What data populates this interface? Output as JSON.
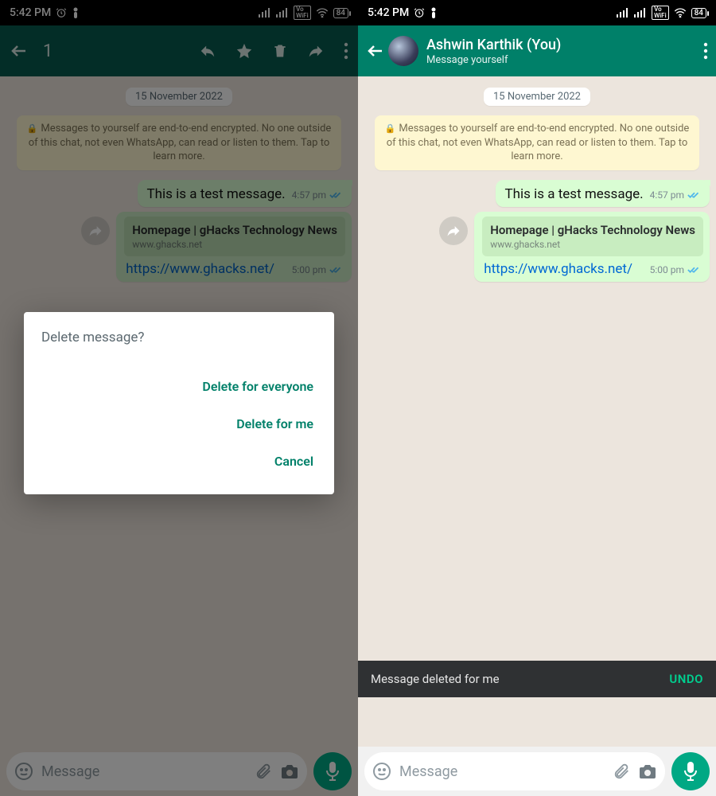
{
  "status": {
    "time": "5:42 PM",
    "battery": "84"
  },
  "left": {
    "selection_count": "1",
    "date_pill": "15 November 2022",
    "encryption_notice": "Messages to yourself are end-to-end encrypted. No one outside of this chat, not even WhatsApp, can read or listen to them. Tap to learn more.",
    "msg1": {
      "text": "This is a test message.",
      "time": "4:57 pm"
    },
    "msg2": {
      "preview_title": "Homepage | gHacks Technology News",
      "preview_domain": "www.ghacks.net",
      "link": "https://www.ghacks.net/",
      "time": "5:00 pm"
    },
    "dialog": {
      "title": "Delete message?",
      "btn_everyone": "Delete for everyone",
      "btn_me": "Delete for me",
      "btn_cancel": "Cancel"
    },
    "composer_placeholder": "Message"
  },
  "right": {
    "contact_name": "Ashwin Karthik (You)",
    "contact_sub": "Message yourself",
    "date_pill": "15 November 2022",
    "encryption_notice": "Messages to yourself are end-to-end encrypted. No one outside of this chat, not even WhatsApp, can read or listen to them. Tap to learn more.",
    "msg1": {
      "text": "This is a test message.",
      "time": "4:57 pm"
    },
    "msg2": {
      "preview_title": "Homepage | gHacks Technology News",
      "preview_domain": "www.ghacks.net",
      "link": "https://www.ghacks.net/",
      "time": "5:00 pm"
    },
    "snackbar_text": "Message deleted for me",
    "snackbar_action": "UNDO",
    "composer_placeholder": "Message"
  }
}
